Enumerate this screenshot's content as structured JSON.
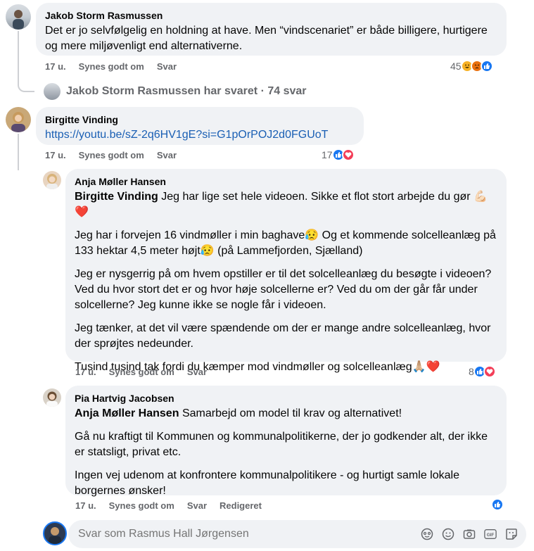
{
  "comments": [
    {
      "author": "Jakob Storm Rasmussen",
      "text": "Det er jo selvfølgelig en holdning at have. Men “vindscenariet” er både billigere, hurtigere og mere miljøvenligt end alternativerne.",
      "time": "17 u.",
      "like": "Synes godt om",
      "reply": "Svar",
      "reaction_count": "45",
      "reactions": [
        "haha-icon",
        "angry-icon",
        "like-icon"
      ]
    },
    {
      "author": "Birgitte Vinding",
      "link": "https://youtu.be/sZ-2q6HV1gE?si=G1pOrPOJ2d0FGUoT",
      "time": "17 u.",
      "like": "Synes godt om",
      "reply": "Svar",
      "reaction_count": "17",
      "reactions": [
        "like-icon",
        "love-icon"
      ]
    },
    {
      "author": "Anja Møller Hansen",
      "mention": "Birgitte Vinding",
      "p1_rest": "Jeg har lige set hele videoen. Sikke et flot stort arbejde du gør 💪🏻❤️",
      "p2": "Jeg har i forvejen 16 vindmøller i min baghave😥 Og et kommende solcelleanlæg på 133 hektar 4,5 meter højt😥 (på Lammefjorden, Sjælland)",
      "p3": "Jeg er nysgerrig på om hvem opstiller er til det solcelleanlæg du besøgte i videoen? Ved du hvor stort det er og hvor høje solcellerne er? Ved du om der går får under solcellerne? Jeg kunne ikke se nogle får i videoen.",
      "p4": "Jeg tænker, at det vil være spændende om der er mange andre solcelleanlæg, hvor der sprøjtes nedeunder.",
      "p5": "Tusind tusind tak fordi du kæmper mod vindmøller og solcelleanlæg🙏🏼❤️",
      "time": "17 u.",
      "like": "Synes godt om",
      "reply": "Svar",
      "reaction_count": "8",
      "reactions": [
        "like-icon",
        "love-icon"
      ]
    },
    {
      "author": "Pia Hartvig Jacobsen",
      "mention": "Anja Møller Hansen",
      "p1_rest": "Samarbejd om model til krav og alternativet!",
      "p2": "Gå nu kraftigt til Kommunen og kommunalpolitikerne, der jo godkender alt, der ikke er statsligt, privat etc.",
      "p3": "Ingen vej udenom at konfrontere kommunalpolitikere - og hurtigt samle lokale borgernes ønsker!",
      "time": "17 u.",
      "like": "Synes godt om",
      "reply": "Svar",
      "edit": "Redigeret",
      "reactions": [
        "like-icon"
      ]
    }
  ],
  "replies_summary": "Jakob Storm Rasmussen har svaret · 74 svar",
  "composer": {
    "placeholder": "Svar som Rasmus Hall Jørgensen"
  },
  "composer_icons": [
    "avatar-sticker-icon",
    "emoji-icon",
    "camera-icon",
    "gif-icon",
    "sticker-icon"
  ],
  "colors": {
    "like": "#1877f2",
    "love": "#f33e58",
    "angry": "#e9710f",
    "haha": "#f7b125",
    "link": "#1a5fb4",
    "bubble": "#f0f2f5",
    "meta": "#65676b"
  }
}
